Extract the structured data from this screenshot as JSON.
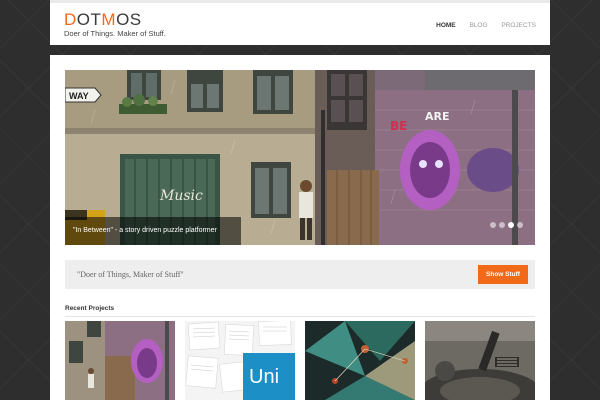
{
  "site": {
    "logo_part1": "D",
    "logo_part2": "OT",
    "logo_part3": "M",
    "logo_part4": "OS",
    "tagline": "Doer of Things. Maker of Stuff.",
    "accent_color": "#f06a19"
  },
  "nav": {
    "items": [
      {
        "label": "HOME",
        "active": true
      },
      {
        "label": "BLOG",
        "active": false
      },
      {
        "label": "PROJECTS",
        "active": false
      }
    ]
  },
  "slider": {
    "caption": "\"In Between\" - a story driven puzzle platformer",
    "slide_count": 4,
    "active_slide": 3,
    "sign_text": "WAY",
    "graffiti_text": "Music"
  },
  "callout": {
    "text": "\"Doer of Things, Maker of Stuff\"",
    "button_label": "Show Stuff"
  },
  "recent_projects": {
    "title": "Recent Projects",
    "items": [
      {
        "icon": "street-game-thumbnail-icon"
      },
      {
        "icon": "newspaper-collage-thumbnail-icon",
        "label": "Uni"
      },
      {
        "icon": "geometric-shapes-thumbnail-icon"
      },
      {
        "icon": "machine-render-thumbnail-icon"
      }
    ]
  }
}
